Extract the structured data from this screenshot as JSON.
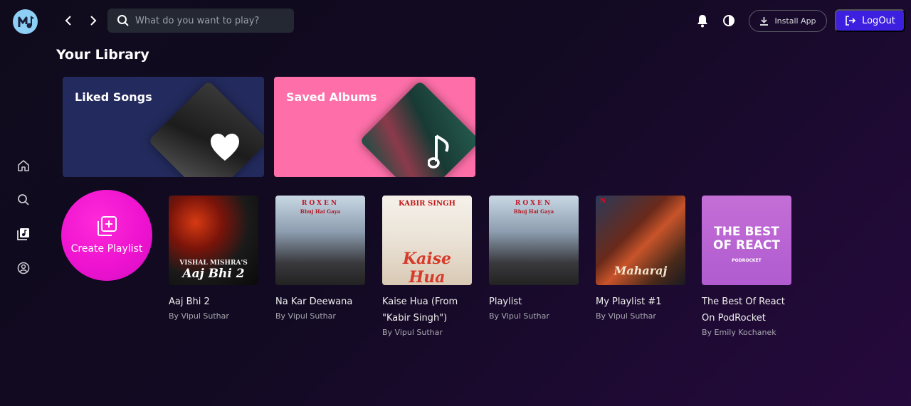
{
  "header": {
    "search_placeholder": "What do you want to play?",
    "install_label": "Install App",
    "logout_label": "LogOut"
  },
  "sidebar": {
    "items": [
      {
        "icon": "home-icon"
      },
      {
        "icon": "search-icon"
      },
      {
        "icon": "library-icon"
      },
      {
        "icon": "profile-icon"
      }
    ]
  },
  "library": {
    "title": "Your Library",
    "liked_title": "Liked Songs",
    "saved_title": "Saved Albums"
  },
  "create_playlist_label": "Create Playlist",
  "playlists": [
    {
      "name": "Aaj Bhi 2",
      "owner": "By Vipul Suthar",
      "cover_text": "Aaj Bhi 2",
      "cover_small": "VISHAL MISHRA'S"
    },
    {
      "name": "Na Kar Deewana",
      "owner": "By Vipul Suthar",
      "cover_text": "ROXEN",
      "cover_small": "Bhuj Hai Gaya"
    },
    {
      "name": "Kaise Hua (From \"Kabir Singh\")",
      "owner": "By Vipul Suthar",
      "cover_text": "Kaise Hua",
      "cover_small": "KABIR SINGH"
    },
    {
      "name": "Playlist",
      "owner": "By Vipul Suthar",
      "cover_text": "ROXEN",
      "cover_small": "Bhuj Hai Gaya"
    },
    {
      "name": "My Playlist #1",
      "owner": "By Vipul Suthar",
      "cover_text": "Maharaj",
      "cover_small": "N"
    },
    {
      "name": "The Best Of React On PodRocket",
      "owner": "By Emily Kochanek",
      "cover_text": "THE BEST OF REACT",
      "cover_small": "PODROCKET"
    }
  ],
  "colors": {
    "accent": "#3d1fe0",
    "liked_bg": "#232b5e",
    "saved_bg": "#fe6fa9",
    "create_bg": "#ee13d0"
  }
}
